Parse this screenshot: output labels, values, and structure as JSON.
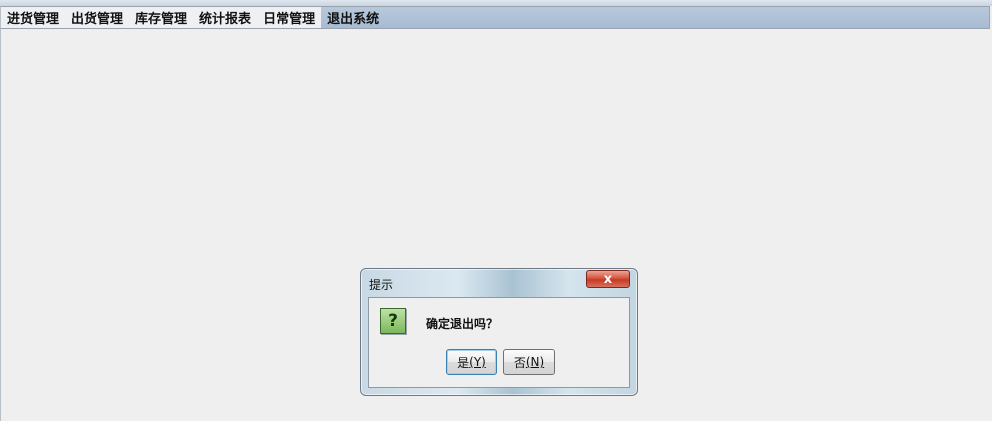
{
  "menu": {
    "items": [
      {
        "label": "进货管理"
      },
      {
        "label": "出货管理"
      },
      {
        "label": "库存管理"
      },
      {
        "label": "统计报表"
      },
      {
        "label": "日常管理"
      },
      {
        "label": "退出系统"
      }
    ]
  },
  "dialog": {
    "title": "提示",
    "close_glyph": "x",
    "message": "确定退出吗？",
    "icon": "question-icon",
    "icon_glyph": "?",
    "yes_label": "是",
    "yes_mnemonic": "(Y)",
    "no_label": "否",
    "no_mnemonic": "(N)"
  }
}
